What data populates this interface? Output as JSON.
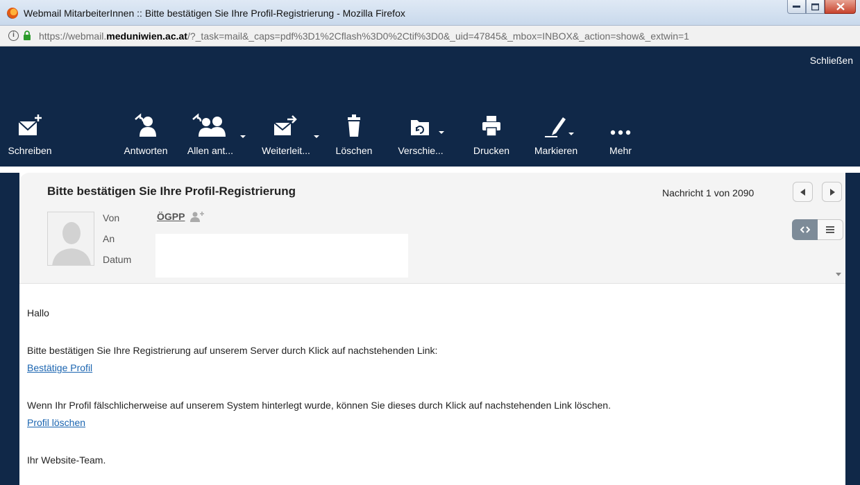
{
  "window": {
    "title": "Webmail MitarbeiterInnen :: Bitte bestätigen Sie Ihre Profil-Registrierung - Mozilla Firefox",
    "controls": {
      "minimize": "minimize",
      "maximize": "maximize",
      "close": "close"
    }
  },
  "address_bar": {
    "url_prefix": "https://webmail.",
    "url_domain": "meduniwien.ac.at",
    "url_rest": "/?_task=mail&_caps=pdf%3D1%2Cflash%3D0%2Ctif%3D0&_uid=47845&_mbox=INBOX&_action=show&_extwin=1"
  },
  "header": {
    "close_link": "Schließen"
  },
  "toolbar": [
    {
      "label": "Schreiben",
      "icon": "compose-icon"
    },
    {
      "label": "Antworten",
      "icon": "reply-icon"
    },
    {
      "label": "Allen ant...",
      "icon": "reply-all-icon"
    },
    {
      "label": "Weiterleit...",
      "icon": "forward-icon"
    },
    {
      "label": "Löschen",
      "icon": "trash-icon"
    },
    {
      "label": "Verschie...",
      "icon": "move-folder-icon"
    },
    {
      "label": "Drucken",
      "icon": "print-icon"
    },
    {
      "label": "Markieren",
      "icon": "mark-icon"
    },
    {
      "label": "Mehr",
      "icon": "more-icon"
    }
  ],
  "message": {
    "subject": "Bitte bestätigen Sie Ihre Profil-Registrierung",
    "from_label": "Von",
    "from_value": "ÖGPP",
    "to_label": "An",
    "date_label": "Datum",
    "counter": "Nachricht 1 von 2090",
    "body": {
      "greeting": "Hallo",
      "line1": "Bitte bestätigen Sie Ihre Registrierung auf unserem Server durch Klick auf nachstehenden Link:",
      "link1": "Bestätige Profil",
      "line2": "Wenn Ihr Profil fälschlicherweise auf unserem System hinterlegt wurde, können Sie dieses durch Klick auf nachstehenden Link löschen.",
      "link2": "Profil löschen",
      "signature": "Ihr Website-Team."
    }
  },
  "colors": {
    "appbar": "#102848",
    "link": "#1a64b0",
    "panel": "#f4f4f4"
  }
}
